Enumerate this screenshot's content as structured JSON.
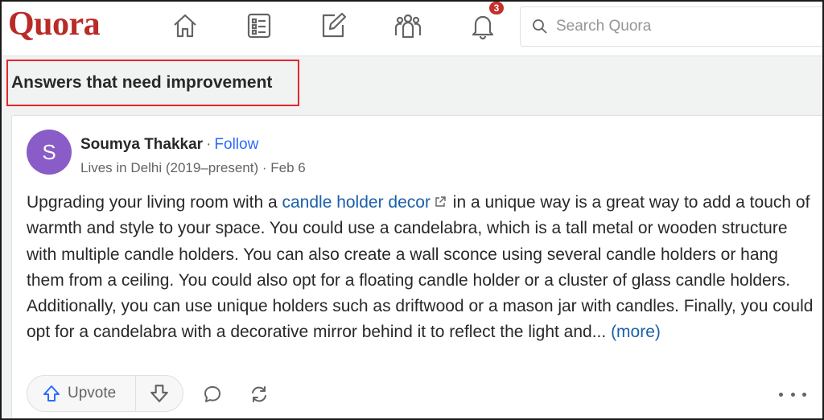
{
  "brand": {
    "logo_text": "Quora",
    "color": "#b92b27"
  },
  "nav": {
    "items": [
      {
        "name": "home",
        "icon": "home-icon"
      },
      {
        "name": "following",
        "icon": "list-icon"
      },
      {
        "name": "answer",
        "icon": "edit-icon"
      },
      {
        "name": "spaces",
        "icon": "people-icon"
      },
      {
        "name": "notifications",
        "icon": "bell-icon",
        "badge": "3"
      }
    ],
    "search_placeholder": "Search Quora"
  },
  "section": {
    "title": "Answers that need improvement"
  },
  "answer_card": {
    "avatar_letter": "S",
    "avatar_color": "#8a5cc7",
    "author": "Soumya Thakkar",
    "separator": "·",
    "follow_label": "Follow",
    "credential": "Lives in Delhi (2019–present)",
    "date_separator": "·",
    "date": "Feb 6",
    "text_before_link": "Upgrading your living room with a ",
    "link_text": "candle holder decor",
    "text_after_link": " in a unique way is a great way to add a touch of warmth and style to your space. You could use a candelabra, which is a tall metal or wooden structure with multiple candle holders. You can also create a wall sconce using several candle holders or hang them from a ceiling. You could also opt for a floating candle holder or a cluster of glass candle holders. Additionally, you can use unique holders such as driftwood or a mason jar with candles. Finally, you could opt for a candelabra with a decorative mirror behind it to reflect the light and... ",
    "more_label": "(more)",
    "upvote_label": "Upvote"
  },
  "colors": {
    "link": "#195faa",
    "follow": "#2e69ff",
    "highlight_box": "#e0282d",
    "badge": "#c4302b"
  }
}
